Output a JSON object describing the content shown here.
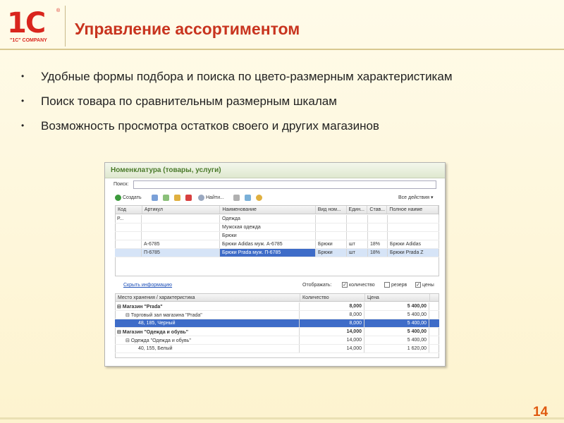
{
  "logo": {
    "text": "1С",
    "sub": "\"1C\" COMPANY",
    "reg": "®"
  },
  "title": "Управление ассортиментом",
  "bullets": [
    "Удобные формы подбора и поиска по цвето-размерным характеристикам",
    "Поиск товара по сравнительным размерным шкалам",
    "Возможность просмотра остатков своего и других магазинов"
  ],
  "bullet_symbol": "•",
  "page_number": "14",
  "window": {
    "title": "Номенклатура (товары, услуги)",
    "search_label": "Поиск:",
    "search_value": "",
    "toolbar": {
      "create": "Создать",
      "find": "Найти...",
      "all_actions": "Все действия ▾"
    },
    "columns": [
      "Код",
      "Артикул",
      "Наименование",
      "Вид ном...",
      "Един...",
      "Став...",
      "Полное наиме"
    ],
    "rows": [
      [
        "Р...",
        "",
        "Одежда",
        "",
        "",
        "",
        ""
      ],
      [
        "",
        "",
        "Мужская одежда",
        "",
        "",
        "",
        ""
      ],
      [
        "",
        "",
        "Брюки",
        "",
        "",
        "",
        ""
      ],
      [
        "",
        "А-6785",
        "Брюки Adidas муж. А-6785",
        "Брюки",
        "шт",
        "18%",
        "Брюки Adidas"
      ],
      [
        "",
        "П-6785",
        "Брюки Prada муж. П-6785",
        "Брюки",
        "шт",
        "18%",
        "Брюки Prada Z"
      ]
    ],
    "hide_info_link": "Скрыть информацию",
    "display_label": "Отображать:",
    "checks": [
      {
        "label": "количество",
        "checked": true
      },
      {
        "label": "резерв",
        "checked": false
      },
      {
        "label": "цены",
        "checked": true
      }
    ],
    "stock_columns": [
      "Место хранения / характеристика",
      "Количество",
      "Цена"
    ],
    "stock_rows": [
      {
        "place": "⊟  Магазин \"Prada\"",
        "qty": "8,000",
        "price": "5 400,00",
        "bold": true,
        "sel": false,
        "indent": 0
      },
      {
        "place": "⊟  Торговый зал магазина \"Prada\"",
        "qty": "8,000",
        "price": "5 400,00",
        "bold": false,
        "sel": false,
        "indent": 12
      },
      {
        "place": "48, 185, Черный",
        "qty": "8,000",
        "price": "5 400,00",
        "bold": false,
        "sel": true,
        "indent": 30
      },
      {
        "place": "⊟  Магазин \"Одежда и обувь\"",
        "qty": "14,000",
        "price": "5 400,00",
        "bold": true,
        "sel": false,
        "indent": 0
      },
      {
        "place": "⊟  Одежда \"Одежда и обувь\"",
        "qty": "14,000",
        "price": "5 400,00",
        "bold": false,
        "sel": false,
        "indent": 12
      },
      {
        "place": "40, 155, Белый",
        "qty": "14,000",
        "price": "1 620,00",
        "bold": false,
        "sel": false,
        "indent": 30
      }
    ]
  },
  "colors": {
    "title": "#c8341f",
    "logo": "#d9251d",
    "page_number": "#e05a10",
    "selection": "#3e6cc8"
  }
}
